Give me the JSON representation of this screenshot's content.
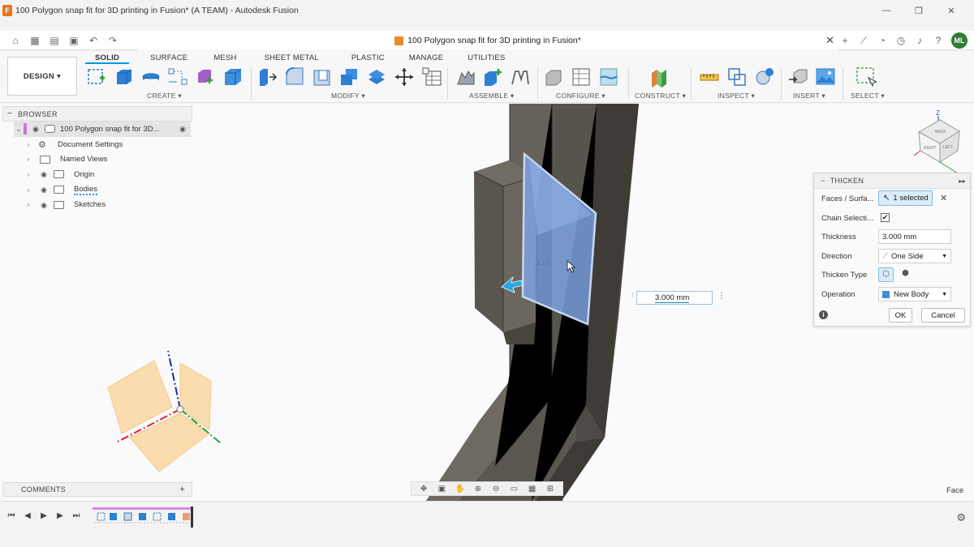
{
  "window": {
    "title": "100 Polygon snap fit for 3D printing in Fusion* (A TEAM) - Autodesk Fusion",
    "logo_letter": "F"
  },
  "tab": {
    "title": "100 Polygon snap fit for 3D printing in Fusion*",
    "user_initials": "ML"
  },
  "toolbar": {
    "workspace": "DESIGN ▾",
    "tabs": [
      "SOLID",
      "SURFACE",
      "MESH",
      "SHEET METAL",
      "PLASTIC",
      "MANAGE",
      "UTILITIES"
    ],
    "groups": [
      "CREATE ▾",
      "MODIFY ▾",
      "ASSEMBLE ▾",
      "CONFIGURE ▾",
      "CONSTRUCT ▾",
      "INSPECT ▾",
      "INSERT ▾",
      "SELECT ▾"
    ]
  },
  "browser": {
    "header": "BROWSER",
    "root": "100 Polygon snap fit for 3D...",
    "items": [
      "Document Settings",
      "Named Views",
      "Origin",
      "Bodies",
      "Sketches"
    ]
  },
  "comments": {
    "header": "COMMENTS"
  },
  "dialog": {
    "title": "THICKEN",
    "faces_label": "Faces / Surfa...",
    "faces_value": "1 selected",
    "chain_label": "Chain Selecti...",
    "thickness_label": "Thickness",
    "thickness_value": "3.000 mm",
    "direction_label": "Direction",
    "direction_value": "One Side",
    "type_label": "Thicken Type",
    "operation_label": "Operation",
    "operation_value": "New Body",
    "ok": "OK",
    "cancel": "Cancel"
  },
  "viewport": {
    "dim_value": "3.000 mm",
    "dim_ghost": "3.00",
    "status": "Face",
    "viewcube_faces": [
      "BACK",
      "RIGHT",
      "LEFT"
    ],
    "axis_label": "Z"
  },
  "colors": {
    "accent": "#0696d7",
    "selection_face": "#7ea2e0",
    "body": "#5a5650"
  }
}
